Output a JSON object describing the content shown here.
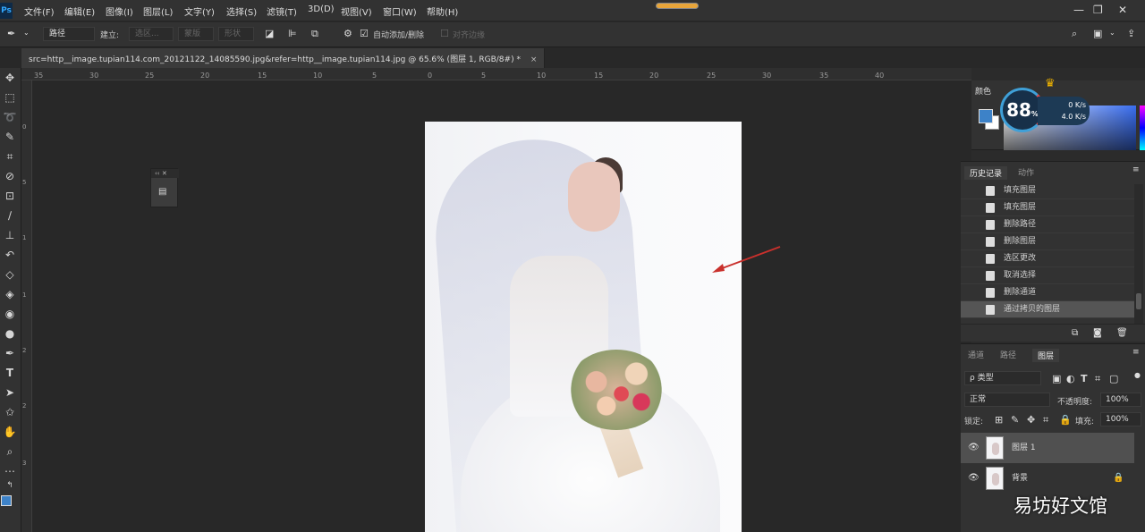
{
  "app": {
    "logo": "Ps"
  },
  "menu": [
    "文件(F)",
    "编辑(E)",
    "图像(I)",
    "图层(L)",
    "文字(Y)",
    "选择(S)",
    "滤镜(T)",
    "3D(D)",
    "视图(V)",
    "窗口(W)",
    "帮助(H)"
  ],
  "window_controls": {
    "minimize": "—",
    "restore": "❐",
    "close": "✕"
  },
  "options": {
    "mode_select": "路径",
    "build_label": "建立:",
    "selection_btn": "选区...",
    "mask_btn": "蒙版",
    "shape_btn": "形状",
    "auto_add_delete": "自动添加/删除",
    "align_edges": "对齐边缘"
  },
  "document": {
    "tab_title": "src=http__image.tupian114.com_20121122_14085590.jpg&refer=http__image.tupian114.jpg  @  65.6%  (图层 1, RGB/8#) *",
    "close": "×"
  },
  "ruler": {
    "h_ticks": [
      "35",
      "30",
      "25",
      "20",
      "15",
      "10",
      "5",
      "0",
      "5",
      "10",
      "15",
      "20",
      "25",
      "30",
      "35",
      "40"
    ],
    "v_ticks": [
      "0",
      "5",
      "1",
      "1",
      "2",
      "2",
      "3"
    ]
  },
  "float_panel": {
    "head": "‹‹ ✕"
  },
  "color_panel": {
    "tab": "颜色",
    "fg_color": "#3d82c8",
    "bg_color": "#ffffff"
  },
  "net_widget": {
    "percent": "88",
    "percent_sign": "%",
    "up": "0 K/s",
    "down": "4.0 K/s"
  },
  "history_panel": {
    "tabs": [
      "历史记录",
      "动作"
    ],
    "items": [
      "填充图层",
      "填充图层",
      "删除路径",
      "删除图层",
      "选区更改",
      "取消选择",
      "删除通道",
      "通过拷贝的图层"
    ]
  },
  "layers_panel": {
    "tabs": [
      "通道",
      "路径",
      "图层"
    ],
    "filter": "ρ 类型",
    "blend_mode": "正常",
    "opacity_label": "不透明度:",
    "opacity_value": "100%",
    "lock_label": "锁定:",
    "fill_label": "填充:",
    "fill_value": "100%",
    "layers": [
      {
        "name": "图层 1"
      },
      {
        "name": "背景"
      }
    ]
  },
  "watermark": "易坊好文馆"
}
